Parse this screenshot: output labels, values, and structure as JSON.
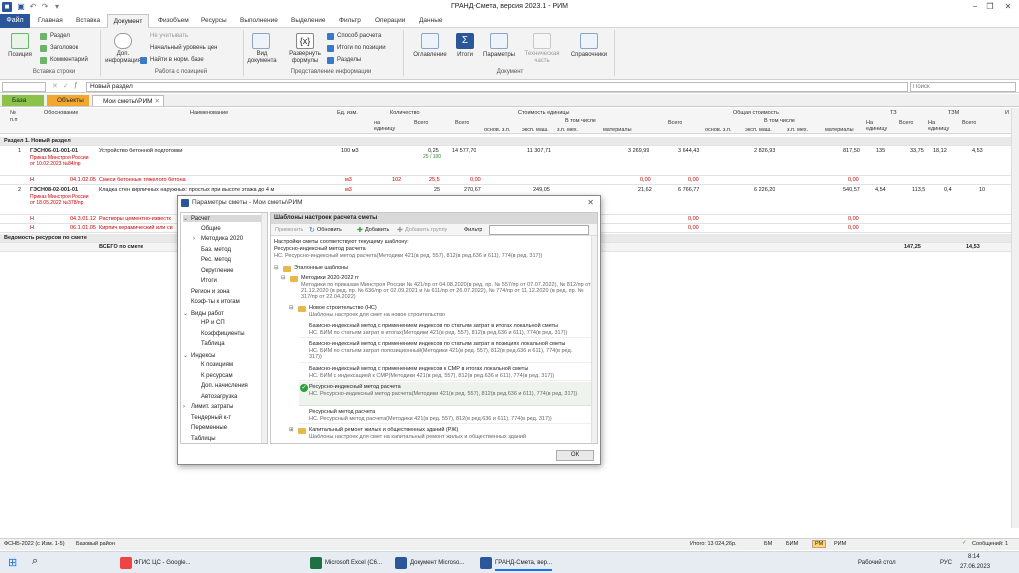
{
  "app": {
    "title": "ГРАНД-Смета, версия 2023.1 - РИМ"
  },
  "menu": {
    "file": "Файл",
    "items": [
      "Главная",
      "Вставка",
      "Документ",
      "Физобъем",
      "Ресурсы",
      "Выполнение",
      "Выделение",
      "Фильтр",
      "Операции",
      "Данные"
    ]
  },
  "ribbon": {
    "insert": {
      "position": "Позиция",
      "section": "Раздел",
      "header": "Заголовок",
      "comment": "Комментарий",
      "group": "Вставка строки"
    },
    "positions": {
      "add_info": "Доп. информация",
      "not_counted": "Не учитывать",
      "start_price_level": "Начальный уровень цен",
      "find_in_base": "Найти в норм. базе",
      "group": "Работа с позицией"
    },
    "view": {
      "view_doc": "Вид документа",
      "expand_formulas": "Развернуть формулы",
      "calc_method": "Способ расчета",
      "totals_by_position": "Итоги по позиции",
      "sections": "Разделы",
      "group": "Представление информации"
    },
    "document": {
      "toc": "Оглавление",
      "totals": "Итоги",
      "params": "Параметры",
      "tech_part": "Техническая часть",
      "references": "Справочники",
      "group": "Документ"
    }
  },
  "formula_bar": {
    "cell_value": "Новый раздел",
    "search_placeholder": "Поиск"
  },
  "doc_tabs": [
    {
      "label": "База"
    },
    {
      "label": "Объекты"
    },
    {
      "label": "Мои сметы\\РИМ"
    }
  ],
  "grid": {
    "headers": {
      "num": "№ п.п",
      "basis": "Обоснование",
      "name": "Наименование",
      "unit": "Ед. изм.",
      "qty": "Количество",
      "qty_per_unit": "на единицу",
      "qty_total": "Всего",
      "unit_cost": "Стоимость единицы",
      "total_cost": "Общая стоимость",
      "uc_total": "Всего",
      "uc_incl": "В том числе",
      "tc_total": "Всего",
      "tc_incl": "В том числе",
      "osn_zp": "основ. з.п.",
      "exp_mash": "эксп. маш.",
      "zp_mech": "з.п. мех.",
      "materials": "материалы",
      "tz": "ТЗ",
      "tzm": "ТЗМ",
      "per_unit": "На единицу",
      "total": "Всего",
      "and": "И"
    },
    "section1": "Раздел 1. Новый раздел",
    "rows": [
      {
        "num": "1",
        "code": "ГЭСН06-01-001-01",
        "order": "Приказ Минстроя России от 10.02.2023 №84/пр",
        "name": "Устройство бетонной подготовки",
        "unit": "100 м3",
        "qty_unit": "",
        "qty_total": "0,25",
        "qty_total2": "25 / 100",
        "uc_total": "14 577,70",
        "uc_osn": "",
        "uc_exp": "11 307,71",
        "uc_zp": "",
        "uc_mat": "3 269,99",
        "tc_total": "3 644,43",
        "tc_osn": "",
        "tc_exp": "2 826,93",
        "tc_zp": "",
        "tc_mat": "817,50",
        "tz_unit": "135",
        "tz_total": "33,75",
        "tzm_unit": "18,12",
        "tzm_total": "4,53"
      },
      {
        "code": "04.1.02.05",
        "name": "Смеси бетонные тяжелого бетона",
        "unit": "м3",
        "qty_unit": "102",
        "qty_total": "25,5",
        "uc_total": "0,00",
        "uc_mat": "0,00",
        "tc_total": "0,00",
        "tc_mat": "0,00"
      },
      {
        "num": "2",
        "code": "ГЭСН08-02-001-01",
        "order": "Приказ Минстроя России от 18.05.2022 №378/пр",
        "name": "Кладка стен кирпичных наружных: простых при высоте этажа до 4 м",
        "unit": "м3",
        "qty_unit": "",
        "qty_total": "25",
        "uc_total": "270,67",
        "uc_exp": "249,05",
        "uc_mat": "21,62",
        "tc_total": "6 766,77",
        "tc_exp": "6 226,20",
        "tc_mat": "540,57",
        "tz_unit": "4,54",
        "tz_total": "113,5",
        "tzm_unit": "0,4",
        "tzm_total": "10"
      },
      {
        "code": "04.3.01.12",
        "name": "Растворы цементно-известк",
        "tc_total": "0,00",
        "tc_mat": "0,00"
      },
      {
        "code": "06.1.01.05",
        "name": "Кирпич керамический или си",
        "tc_total": "0,00",
        "tc_mat": "0,00"
      }
    ],
    "resources_row": "Ведомость ресурсов по смете",
    "total_row": {
      "label": "ВСЕГО по смете",
      "tz_total": "147,25",
      "tzm_total": "14,53"
    }
  },
  "dialog": {
    "title": "Параметры сметы - Мои сметы\\РИМ",
    "tree": [
      {
        "label": "Расчет",
        "level": 0,
        "expanded": true,
        "selected": true
      },
      {
        "label": "Общие",
        "level": 1
      },
      {
        "label": "Методика 2020",
        "level": 1,
        "arrow": true
      },
      {
        "label": "Баз. метод",
        "level": 1
      },
      {
        "label": "Рес. метод",
        "level": 1
      },
      {
        "label": "Округление",
        "level": 1
      },
      {
        "label": "Итоги",
        "level": 1
      },
      {
        "label": "Регион и зона",
        "level": 0
      },
      {
        "label": "Коэф-ты к итогам",
        "level": 0
      },
      {
        "label": "Виды работ",
        "level": 0,
        "expanded": true
      },
      {
        "label": "НР и СП",
        "level": 1
      },
      {
        "label": "Коэффициенты",
        "level": 1
      },
      {
        "label": "Таблица",
        "level": 1
      },
      {
        "label": "Индексы",
        "level": 0,
        "expanded": true
      },
      {
        "label": "К позициям",
        "level": 1
      },
      {
        "label": "К ресурсам",
        "level": 1
      },
      {
        "label": "Доп. начисления",
        "level": 1
      },
      {
        "label": "Автозагрузка",
        "level": 1
      },
      {
        "label": "Лимит. затраты",
        "level": 0,
        "arrow": true
      },
      {
        "label": "Тендерный к-т",
        "level": 0
      },
      {
        "label": "Переменные",
        "level": 0
      },
      {
        "label": "Таблицы",
        "level": 0
      }
    ],
    "panel_title": "Шаблоны настроек расчета сметы",
    "toolbar": {
      "apply": "Применить",
      "refresh": "Обновить",
      "add": "Добавить",
      "add_group": "Добавить группу",
      "filter": "Фильтр"
    },
    "current_note": "Настройки сметы соответствуют текущему шаблону:",
    "current_name": "Ресурсно-индексный метод расчета",
    "current_desc": "НС. Ресурсно-индексный метод расчета(Методики 421(в ред. 557), 812(в ред.636 и 611), 774(в ред. 317))",
    "folder_root": "Эталонные шаблоны",
    "folder_2022": "Методики 2020-2022 гг",
    "folder_2022_desc": "Методики по приказам Минстроя России № 421/пр от 04.08.2020(в ред. пр. № 557/пр от 07.07.2022), № 812/пр от 21.12.2020 (в ред. пр. № 636/пр от 02.09.2021 и № 611/пр от 26.07.2022), № 774/пр от 11.12.2020 (в ред. пр. № 317/пр от 22.04.2022)",
    "folder_new": "Новое строительство (НС)",
    "folder_new_desc": "Шаблоны настроек для смет на новое строительство",
    "templates": [
      {
        "name": "Базисно-индексный метод с применением индексов по статьям затрат в итогах локальной сметы",
        "desc": "НС. БИМ по статьям затрат в итогах(Методики 421(в ред. 557), 812(в ред.636 и 611), 774(в ред. 317))"
      },
      {
        "name": "Базисно-индексный метод с применением индексов по статьям затрат в позициях локальной сметы",
        "desc": "НС. БИМ по статьям затрат попозиционный(Методики 421(в ред. 557), 812(в ред.636 и 611), 774(в ред. 317))"
      },
      {
        "name": "Базисно-индексный метод с применением индексов к СМР в итогах локальной сметы",
        "desc": "НС. БИМ с индексацией к СМР(Методики 421(в ред. 557), 812(в ред.636 и 611), 774(в ред. 317))"
      },
      {
        "name": "Ресурсно-индексный метод расчета",
        "desc": "НС. Ресурсно-индексный метод расчета(Методики 421(в ред. 557), 812(в ред.636 и 611), 774(в ред. 317))",
        "active": true
      },
      {
        "name": "Ресурсный метод расчета",
        "desc": "НС. Ресурсный метод расчета(Методики 421(в ред. 557), 812(в ред.636 и 611), 774(в ред. 317))"
      }
    ],
    "folder_kr": "Капитальный ремонт жилых и общественных зданий (РЖ)",
    "folder_kr_desc": "Шаблоны настроек для смет на капитальный ремонт жилых и общественных зданий",
    "ok": "ОК"
  },
  "status": {
    "left1": "ФСНБ-2022 (с Изм. 1-5)",
    "left2": "Базовый район",
    "total": "Итого: 13 024,26р.",
    "modes": [
      "БМ",
      "БИМ",
      "РМ",
      "РИМ"
    ],
    "active_mode": "РМ",
    "messages": "Сообщений: 1"
  },
  "taskbar": {
    "apps": [
      "ФГИС ЦС - Google...",
      "Microsoft Excel (С6...",
      "Документ Microso...",
      "ГРАНД-Смета, вер..."
    ],
    "desktop": "Рабочий стол",
    "lang": "РУС",
    "time": "8:14",
    "date": "27.06.2023"
  },
  "colors": {
    "accent": "#2b579a",
    "tab_base": "#8bc34a",
    "tab_objects": "#f0a830",
    "red": "#cc0000",
    "green_check": "#2e9e3e"
  }
}
